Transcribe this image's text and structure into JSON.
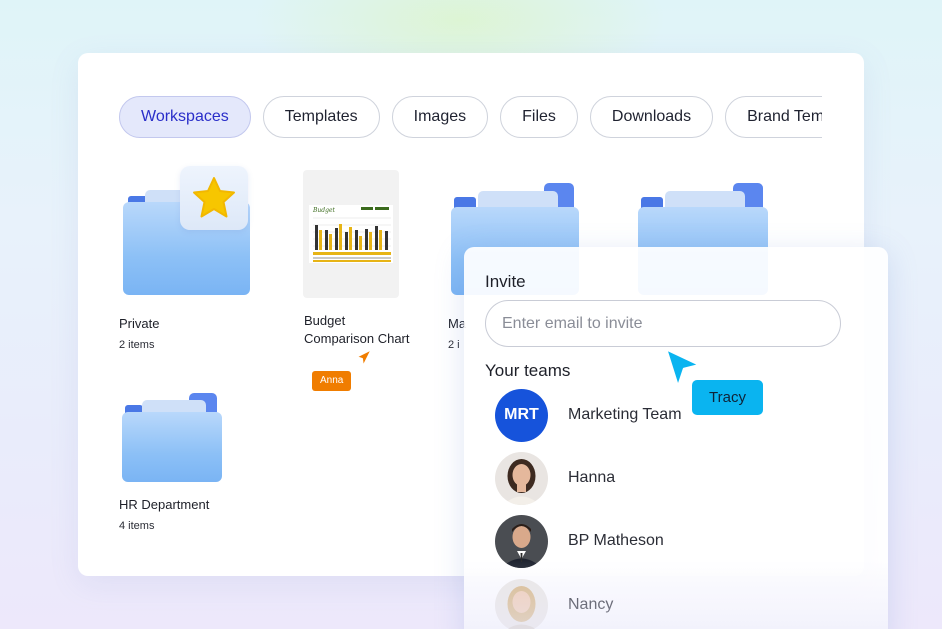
{
  "tabs": [
    {
      "label": "Workspaces",
      "active": true
    },
    {
      "label": "Templates",
      "active": false
    },
    {
      "label": "Images",
      "active": false
    },
    {
      "label": "Files",
      "active": false
    },
    {
      "label": "Downloads",
      "active": false
    },
    {
      "label": "Brand Temp",
      "active": false
    }
  ],
  "items": {
    "private": {
      "title": "Private",
      "subtitle": "2 items",
      "icon": "folder-star-icon"
    },
    "budget": {
      "title_line1": "Budget",
      "title_line2": "Comparison Chart",
      "icon": "chart-document-thumbnail"
    },
    "third": {
      "title": "Ma",
      "subtitle": "2 i",
      "icon": "folder-icon"
    },
    "fourth": {
      "icon": "folder-icon"
    },
    "hr": {
      "title": "HR Department",
      "subtitle": "4 items",
      "icon": "folder-icon"
    }
  },
  "collaborators": {
    "anna": {
      "label": "Anna",
      "color": "#f07d00"
    },
    "tracy": {
      "label": "Tracy",
      "color": "#0ab4f0"
    }
  },
  "invite": {
    "title": "Invite",
    "email_placeholder": "Enter email to invite",
    "email_value": "",
    "teams_title": "Your teams",
    "members": [
      {
        "initials": "MRT",
        "name": "Marketing Team",
        "avatar_color": "#1653db"
      },
      {
        "initials": "",
        "name": "Hanna"
      },
      {
        "initials": "",
        "name": "BP Matheson"
      },
      {
        "initials": "",
        "name": "Nancy"
      }
    ]
  },
  "colors": {
    "accent": "#2a2ec9",
    "folder_front": "#8cc0f6",
    "folder_back": "#5b86ef",
    "star": "#f7c600"
  }
}
